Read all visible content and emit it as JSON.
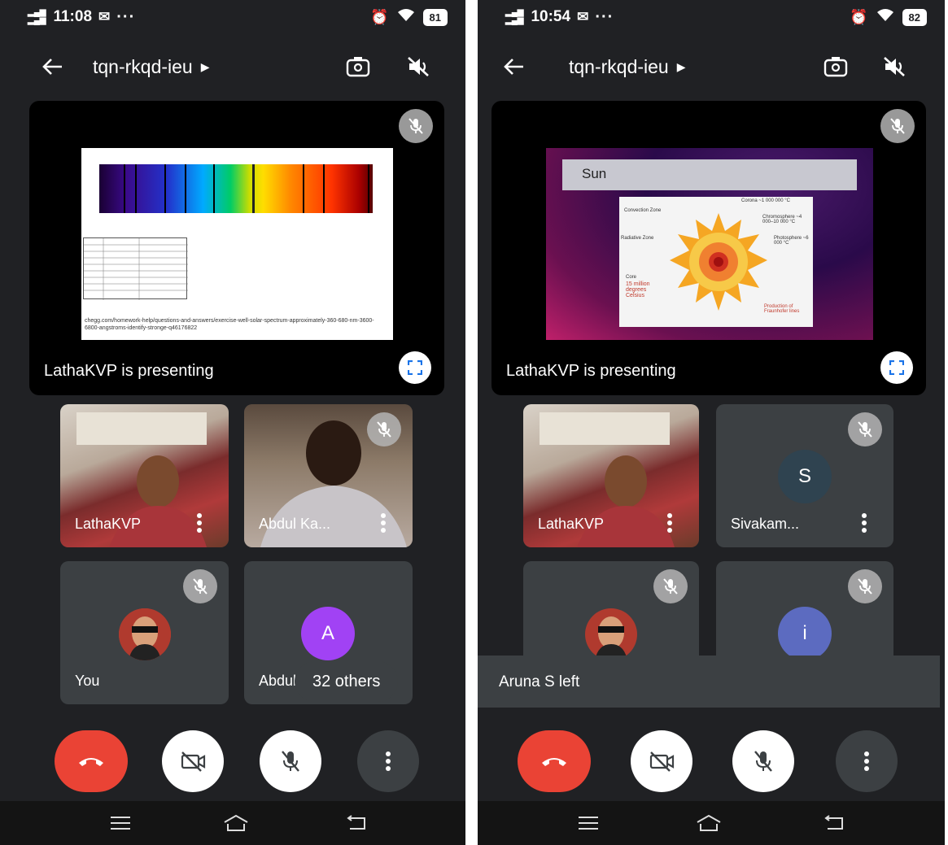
{
  "screens": [
    {
      "status": {
        "signal": "4G 3G",
        "time": "11:08",
        "dots": "···",
        "network": "4G",
        "battery": "81"
      },
      "meeting": {
        "code": "tqn-rkqd-ieu"
      },
      "presentation": {
        "label": "LathaKVP is presenting",
        "slide_url": "chegg.com/homework-help/questions-and-answers/exercise-well-solar-spectrum-approximately-360-680-nm-3600-6800-angstroms-identify-stronge-q46176822"
      },
      "participants": [
        {
          "name": "LathaKVP",
          "type": "video"
        },
        {
          "name": "Abdul Ka...",
          "type": "video",
          "muted": true
        },
        {
          "name": "You",
          "type": "avatar",
          "muted": true
        },
        {
          "name": "Abdul",
          "type": "initial",
          "initial": "A",
          "color": "#a142f4"
        }
      ],
      "others": "32 others"
    },
    {
      "status": {
        "signal": "4G 3G",
        "time": "10:54",
        "dots": "···",
        "battery": "82"
      },
      "meeting": {
        "code": "tqn-rkqd-ieu"
      },
      "presentation": {
        "label": "LathaKVP is presenting",
        "slide_title": "Sun",
        "sun_labels": {
          "corona": "Corona ~1 000 000 °C",
          "chromosphere": "Chromosphere ~4 000–10 000 °C",
          "photosphere": "Photosphere ~6 000 °C",
          "convection": "Convection Zone",
          "radiative": "Radiative Zone",
          "core": "Core",
          "core_temp": "15 million degrees Celsius",
          "fraunhofer": "Production of Fraunhofer lines"
        }
      },
      "participants": [
        {
          "name": "LathaKVP",
          "type": "video"
        },
        {
          "name": "Sivakam...",
          "type": "initial",
          "initial": "S",
          "color": "#3c4f5c",
          "muted": true
        },
        {
          "name": "",
          "type": "avatar",
          "muted": true
        },
        {
          "name": "",
          "type": "initial",
          "initial": "i",
          "color": "#5c6bc0",
          "muted": true
        }
      ],
      "toast": "Aruna S left"
    }
  ]
}
